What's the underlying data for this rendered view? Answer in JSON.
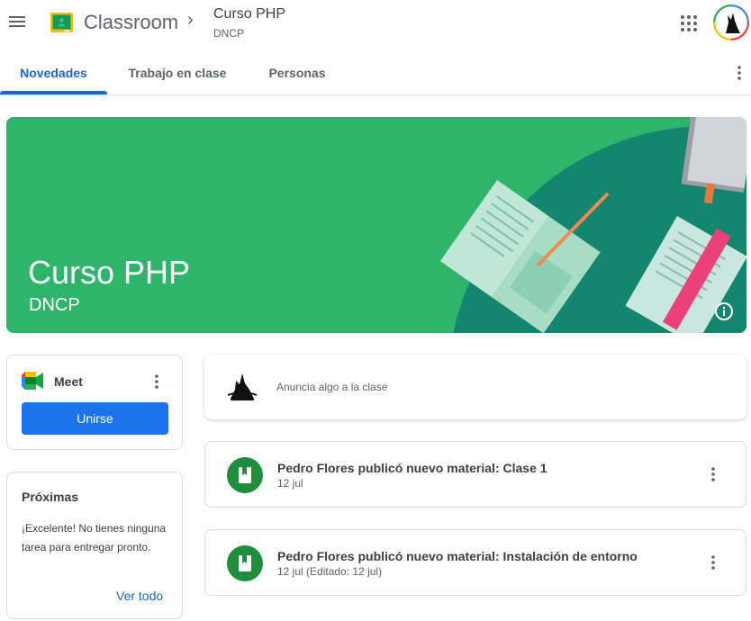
{
  "header": {
    "app_name": "Classroom",
    "course_title": "Curso PHP",
    "course_subtitle": "DNCP",
    "breadcrumb_separator": "›"
  },
  "tabs": [
    {
      "label": "Novedades",
      "active": true
    },
    {
      "label": "Trabajo en clase",
      "active": false
    },
    {
      "label": "Personas",
      "active": false
    }
  ],
  "banner": {
    "title": "Curso PHP",
    "subtitle": "DNCP",
    "color": "#2fb46c"
  },
  "meet": {
    "label": "Meet",
    "join_label": "Unirse"
  },
  "upcoming": {
    "title": "Próximas",
    "message": "¡Excelente! No tienes ninguna tarea para entregar pronto.",
    "view_all_label": "Ver todo"
  },
  "announce": {
    "placeholder": "Anuncia algo a la clase"
  },
  "posts": [
    {
      "title": "Pedro Flores publicó nuevo material: Clase 1",
      "date": "12 jul",
      "icon": "material-icon"
    },
    {
      "title": "Pedro Flores publicó nuevo material: Instalación de entorno",
      "date": "12 jul (Editado: 12 jul)",
      "icon": "material-icon"
    }
  ],
  "colors": {
    "accent": "#1967d2",
    "button": "#1a73e8",
    "material_green": "#1e8e3e"
  }
}
